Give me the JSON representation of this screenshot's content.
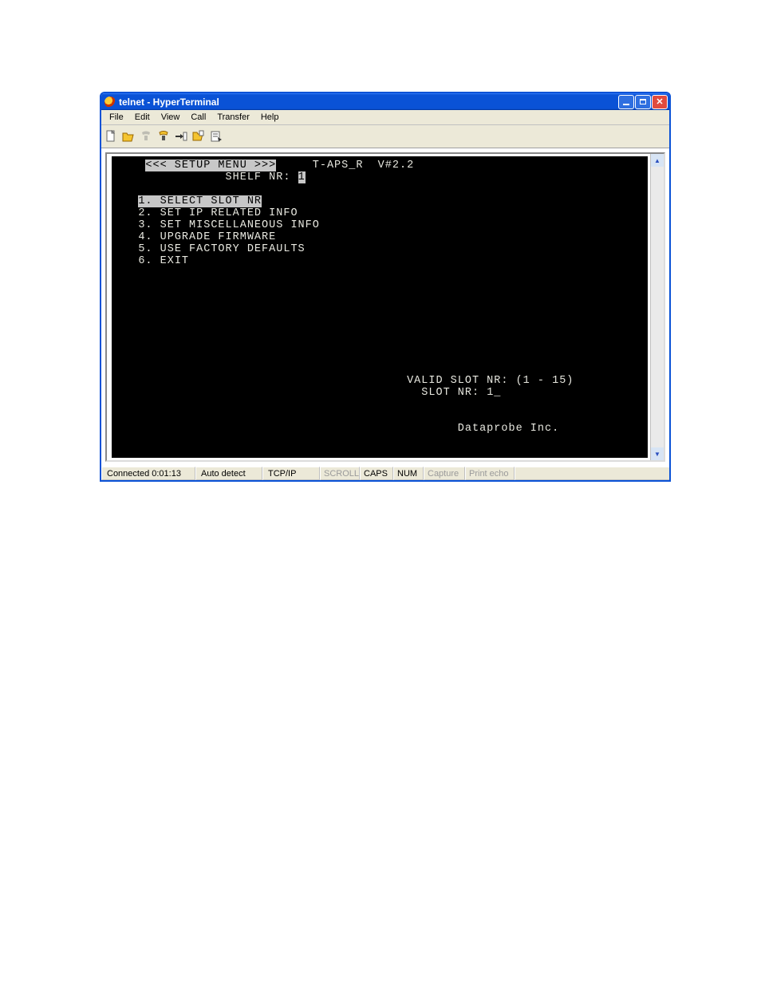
{
  "window": {
    "title": "telnet - HyperTerminal"
  },
  "menu": {
    "file": "File",
    "edit": "Edit",
    "view": "View",
    "call": "Call",
    "transfer": "Transfer",
    "help": "Help"
  },
  "terminal": {
    "menuTitle": "<<< SETUP MENU >>>",
    "appVer": "T-APS_R  V#2.2",
    "shelfLabel": "SHELF NR:",
    "shelfValue": "1",
    "items": [
      "1. SELECT SLOT NR",
      "2. SET IP RELATED INFO",
      "3. SET MISCELLANEOUS INFO",
      "4. UPGRADE FIRMWARE",
      "5. USE FACTORY DEFAULTS",
      "6. EXIT"
    ],
    "validSlot": "VALID SLOT NR: (1 - 15)",
    "slotPrompt": "SLOT NR: ",
    "slotInput": "1",
    "company": "Dataprobe Inc."
  },
  "status": {
    "connected": "Connected 0:01:13",
    "autoDetect": "Auto detect",
    "tcp": "TCP/IP",
    "scroll": "SCROLL",
    "caps": "CAPS",
    "num": "NUM",
    "capture": "Capture",
    "printEcho": "Print echo"
  }
}
